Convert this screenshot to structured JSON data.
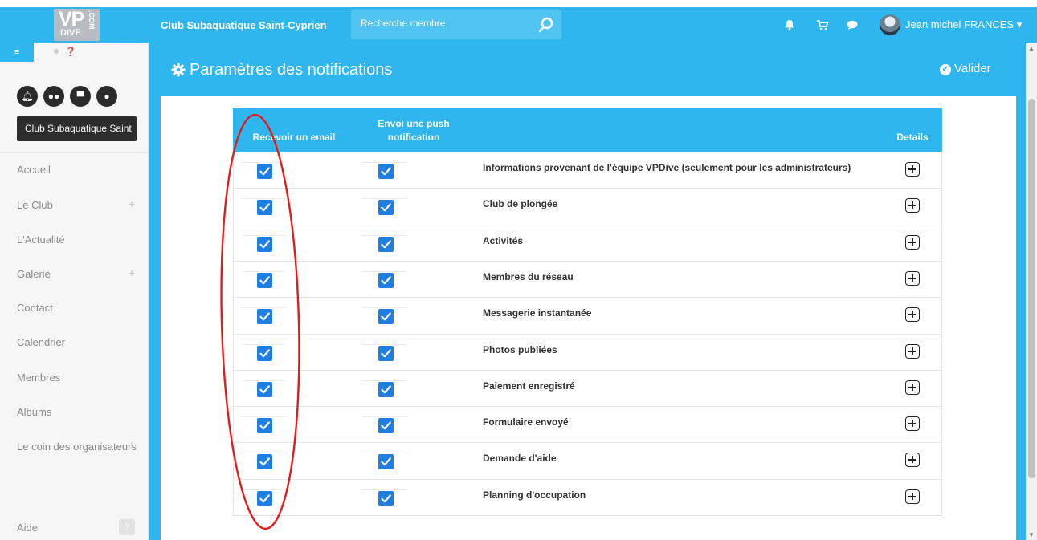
{
  "header": {
    "logo": "VP DIVE .COM",
    "club_name": "Club Subaquatique Saint-Cyprien",
    "search_placeholder": "Recherche membre",
    "user_name": "Jean michel FRANCES"
  },
  "sidebar": {
    "club_tooltip": "Club Subaquatique Saint",
    "items": [
      {
        "label": "Accueil",
        "expandable": false
      },
      {
        "label": "Le Club",
        "expandable": true
      },
      {
        "label": "L'Actualité",
        "expandable": false
      },
      {
        "label": "Galerie",
        "expandable": true
      },
      {
        "label": "Contact",
        "expandable": false
      },
      {
        "label": "Calendrier",
        "expandable": false
      },
      {
        "label": "Membres",
        "expandable": false
      },
      {
        "label": "Albums",
        "expandable": false
      },
      {
        "label": "Le coin des organisateurs",
        "expandable": true
      }
    ],
    "help_label": "Aide"
  },
  "page": {
    "title": "Paramètres des notifications",
    "validate_label": "Valider"
  },
  "table": {
    "headers": {
      "email": "Recevoir un email",
      "push_line1": "Envoi une push",
      "push_line2": "notification",
      "details": "Details"
    },
    "rows": [
      {
        "label": "Informations provenant de l'équipe VPDive (seulement pour les administrateurs)",
        "email": true,
        "push": true
      },
      {
        "label": "Club de plongée",
        "email": true,
        "push": true
      },
      {
        "label": "Activités",
        "email": true,
        "push": true
      },
      {
        "label": "Membres du réseau",
        "email": true,
        "push": true
      },
      {
        "label": "Messagerie instantanée",
        "email": true,
        "push": true
      },
      {
        "label": "Photos publiées",
        "email": true,
        "push": true
      },
      {
        "label": "Paiement enregistré",
        "email": true,
        "push": true
      },
      {
        "label": "Formulaire envoyé",
        "email": true,
        "push": true
      },
      {
        "label": "Demande d'aide",
        "email": true,
        "push": true
      },
      {
        "label": "Planning d'occupation",
        "email": true,
        "push": true
      }
    ]
  },
  "colors": {
    "accent": "#2fb6ee",
    "checkbox": "#1e7fe0",
    "annotation": "#e41b1b"
  }
}
